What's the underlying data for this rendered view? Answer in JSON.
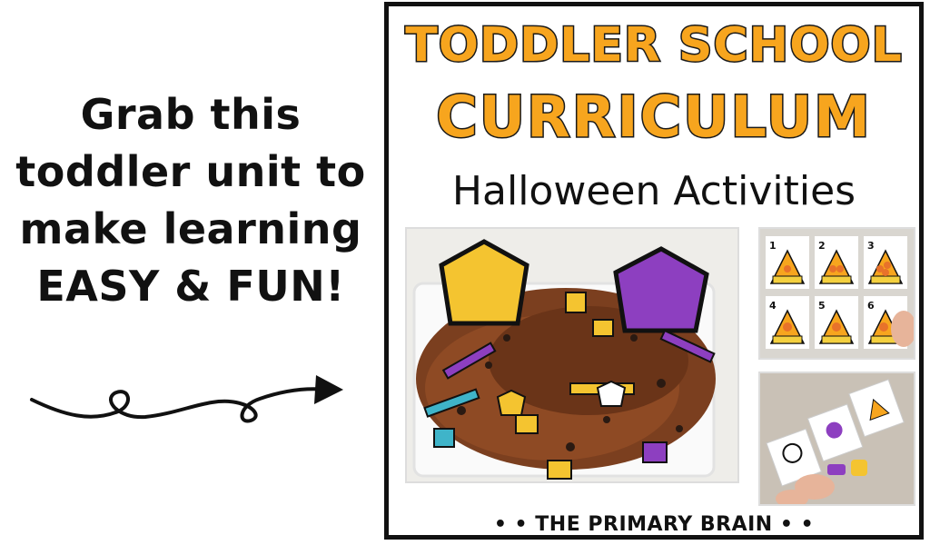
{
  "left_text": {
    "line1": "Grab this",
    "line2": "toddler unit to",
    "line3": "make learning",
    "line4": "EASY & FUN!"
  },
  "card": {
    "title_line1": "TODDLER SCHOOL",
    "title_line2": "CURRICULUM",
    "subtitle": "Halloween Activities",
    "footer": "• • THE PRIMARY BRAIN • •"
  },
  "colors": {
    "title_fill": "#f7a51e",
    "title_outline": "#1a1a1a",
    "border": "#111111",
    "purple": "#7a3fb0",
    "yellow": "#f4c430",
    "bean": "#8a4a25"
  },
  "icons": [
    "curly-arrow-icon"
  ]
}
